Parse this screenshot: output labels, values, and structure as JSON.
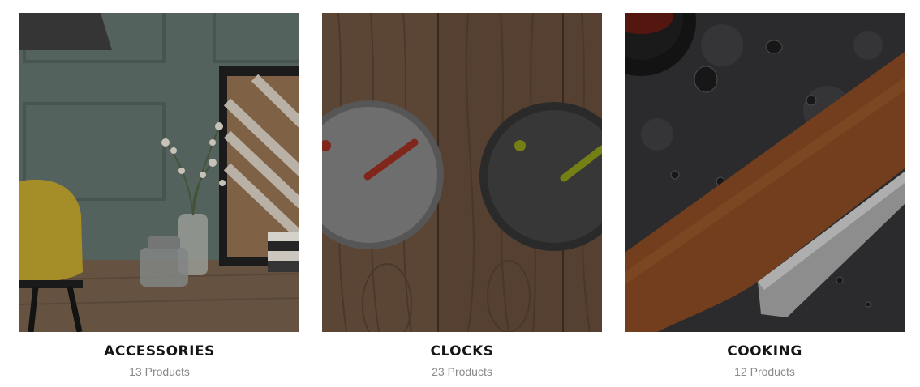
{
  "categories": [
    {
      "title": "ACCESSORIES",
      "count": "13 Products",
      "image": "room-with-plant-and-chair"
    },
    {
      "title": "CLOCKS",
      "count": "23 Products",
      "image": "two-wall-clocks-on-wood"
    },
    {
      "title": "COOKING",
      "count": "12 Products",
      "image": "wooden-knife-on-stone"
    }
  ]
}
